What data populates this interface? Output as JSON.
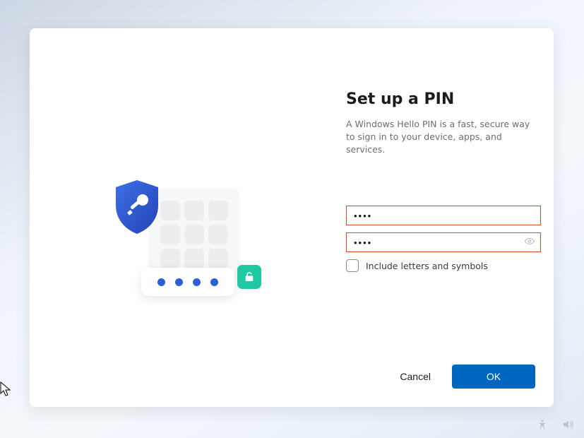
{
  "title": "Set up a PIN",
  "subtitle": "A Windows Hello PIN is a fast, secure way to sign in to your device, apps, and services.",
  "pin_value": "••••",
  "confirm_value": "••••",
  "checkbox_label": "Include letters and symbols",
  "checkbox_checked": false,
  "buttons": {
    "cancel": "Cancel",
    "ok": "OK"
  },
  "colors": {
    "accent": "#0067c0",
    "input_border": "#d05020",
    "badge": "#1fc7a2"
  }
}
